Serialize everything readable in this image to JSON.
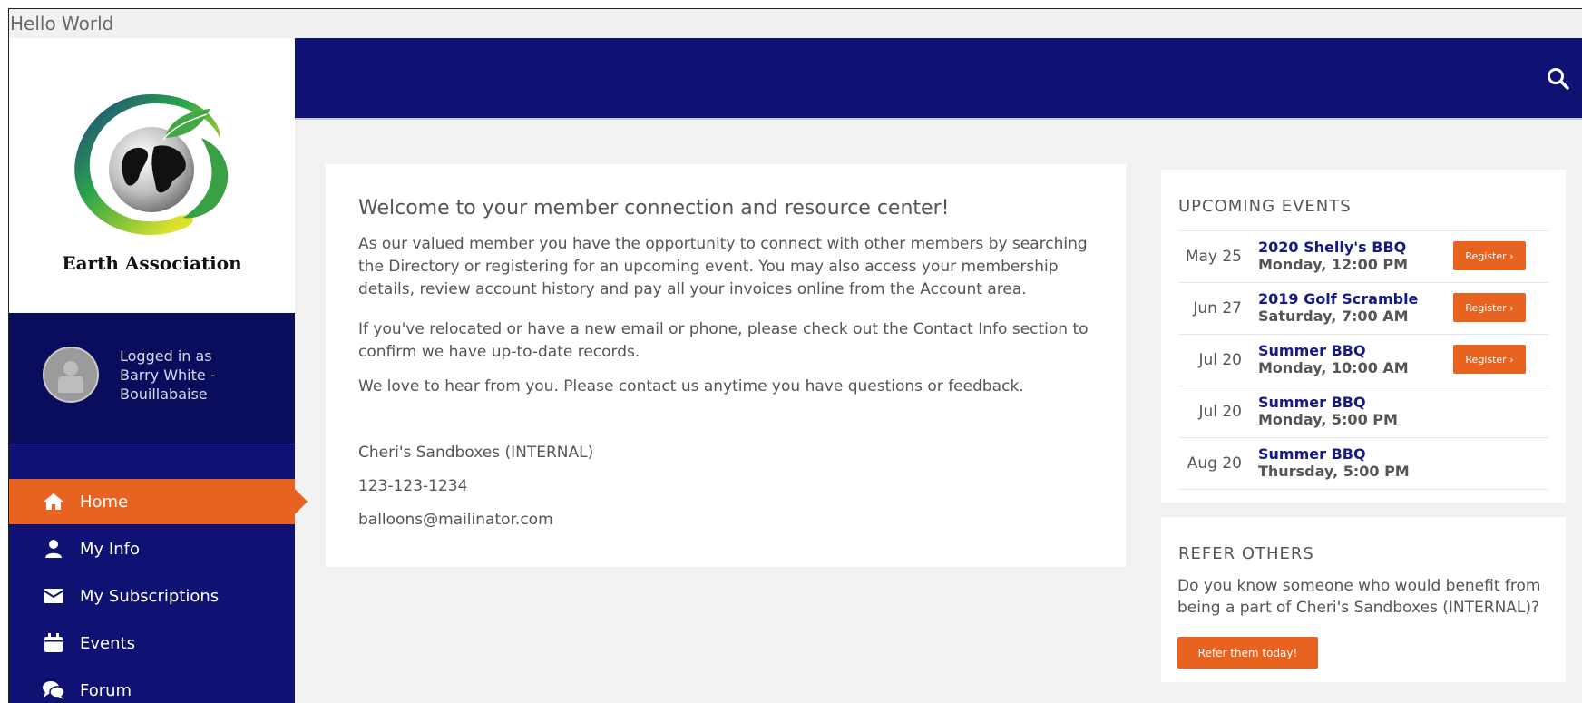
{
  "window": {
    "title": "Hello World"
  },
  "sidebar": {
    "org_name": "Earth Association",
    "user": {
      "logged_in_label": "Logged in as",
      "name": "Barry White -",
      "company": "Bouillabaise"
    },
    "nav": [
      {
        "label": "Home",
        "icon": "home-icon",
        "active": true
      },
      {
        "label": "My Info",
        "icon": "user-icon"
      },
      {
        "label": "My Subscriptions",
        "icon": "envelope-icon"
      },
      {
        "label": "Events",
        "icon": "calendar-icon"
      },
      {
        "label": "Forum",
        "icon": "comments-icon"
      }
    ]
  },
  "header": {
    "search_icon": "search-icon"
  },
  "welcome": {
    "title": "Welcome to your member connection and resource center!",
    "paragraphs": [
      "As our valued member you have the opportunity to connect with other members by searching the Directory or registering for an upcoming event. You may also access your membership details, review account history and pay all your invoices online from the Account area.",
      "If you've relocated or have a new email or phone, please check out the Contact Info section to confirm we have up-to-date records.",
      "We love to hear from you. Please contact us anytime you have questions or feedback."
    ],
    "contact": {
      "org": "Cheri's Sandboxes (INTERNAL)",
      "phone": "123-123-1234",
      "email": "balloons@mailinator.com"
    }
  },
  "events": {
    "heading": "UPCOMING EVENTS",
    "register_label": "Register ›",
    "items": [
      {
        "date": "May 25",
        "name": "2020 Shelly's BBQ",
        "time": "Monday, 12:00 PM",
        "register": true
      },
      {
        "date": "Jun 27",
        "name": "2019 Golf Scramble",
        "time": "Saturday, 7:00 AM",
        "register": true
      },
      {
        "date": "Jul 20",
        "name": "Summer BBQ",
        "time": "Monday, 10:00 AM",
        "register": true
      },
      {
        "date": "Jul 20",
        "name": "Summer BBQ",
        "time": "Monday, 5:00 PM",
        "register": false
      },
      {
        "date": "Aug 20",
        "name": "Summer BBQ",
        "time": "Thursday, 5:00 PM",
        "register": false
      }
    ]
  },
  "refer": {
    "heading": "REFER OTHERS",
    "text": "Do you know someone who would benefit from being a part of Cheri's Sandboxes (INTERNAL)?",
    "button_label": "Refer them today!"
  },
  "colors": {
    "navy": "#0f1272",
    "accent": "#e8631f",
    "link": "#151a85"
  }
}
